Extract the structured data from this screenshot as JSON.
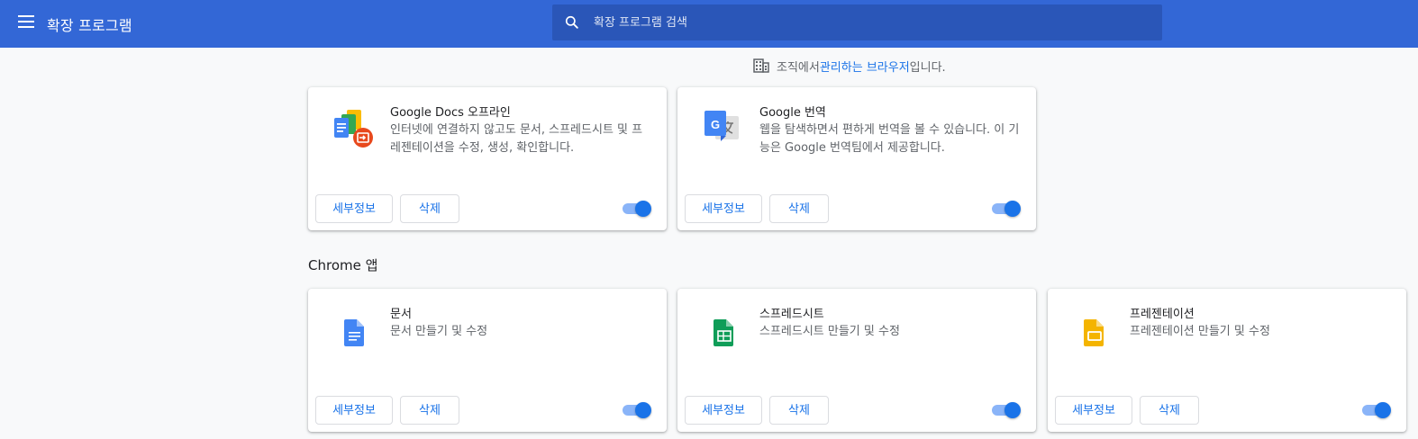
{
  "header": {
    "title": "확장 프로그램",
    "search_placeholder": "확장 프로그램 검색"
  },
  "managed_notice": {
    "prefix": "조직에서 ",
    "link": "관리하는 브라우저",
    "suffix": "입니다."
  },
  "extensions": [
    {
      "name": "Google Docs 오프라인",
      "description": "인터넷에 연결하지 않고도 문서, 스프레드시트 및 프레젠테이션을 수정, 생성, 확인합니다.",
      "details_label": "세부정보",
      "remove_label": "삭제",
      "enabled": true,
      "icon": "docs-offline-icon"
    },
    {
      "name": "Google 번역",
      "description": "웹을 탐색하면서 편하게 번역을 볼 수 있습니다. 이 기능은 Google 번역팀에서 제공합니다.",
      "details_label": "세부정보",
      "remove_label": "삭제",
      "enabled": true,
      "icon": "translate-icon"
    }
  ],
  "apps_section": {
    "title": "Chrome 앱",
    "items": [
      {
        "name": "문서",
        "description": "문서 만들기 및 수정",
        "details_label": "세부정보",
        "remove_label": "삭제",
        "enabled": true,
        "icon": "docs-icon"
      },
      {
        "name": "스프레드시트",
        "description": "스프레드시트 만들기 및 수정",
        "details_label": "세부정보",
        "remove_label": "삭제",
        "enabled": true,
        "icon": "sheets-icon"
      },
      {
        "name": "프레젠테이션",
        "description": "프레젠테이션 만들기 및 수정",
        "details_label": "세부정보",
        "remove_label": "삭제",
        "enabled": true,
        "icon": "slides-icon"
      }
    ]
  },
  "colors": {
    "header_bg": "#3367d6",
    "accent": "#1a73e8"
  }
}
